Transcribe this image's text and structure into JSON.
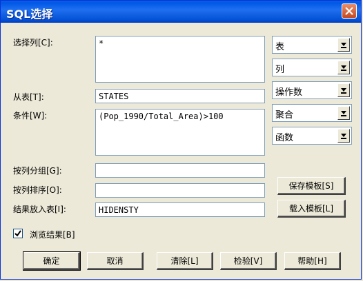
{
  "window": {
    "title": "SQL选择"
  },
  "labels": {
    "select_columns": "选择列[C]:",
    "from_table": "从表[T]:",
    "condition": "条件[W]:",
    "group_by": "按列分组[G]:",
    "order_by": "按列排序[O]:",
    "result_table": "结果放入表[I]:",
    "browse_results": "浏览结果[B]"
  },
  "fields": {
    "select_columns": "*",
    "from_table": "STATES",
    "condition": "(Pop_1990/Total_Area)>100",
    "group_by": "",
    "order_by": "",
    "result_table": "HIDENSTY"
  },
  "combos": {
    "table": "表",
    "column": "列",
    "operator": "操作数",
    "aggregate": "聚合",
    "function": "函数"
  },
  "buttons": {
    "save_template": "保存模板[S]",
    "load_template": "载入模板[L]",
    "ok": "确定",
    "cancel": "取消",
    "clear": "清除[L]",
    "verify": "检验[V]",
    "help": "帮助[H]"
  },
  "checkbox": {
    "browse_results_checked": true
  }
}
